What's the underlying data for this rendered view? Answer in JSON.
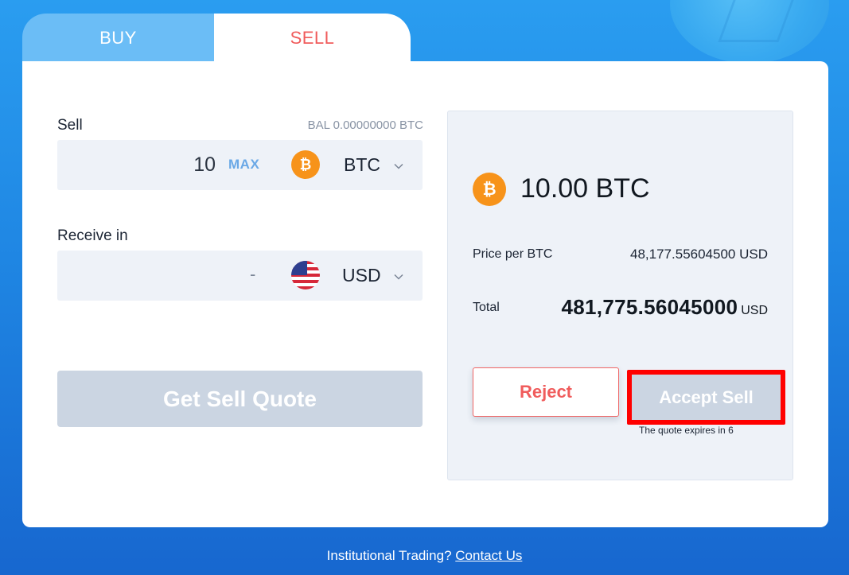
{
  "tabs": {
    "buy": "BUY",
    "sell": "SELL"
  },
  "sell_field": {
    "label": "Sell",
    "balance": "BAL 0.00000000 BTC",
    "amount": "10",
    "max_label": "MAX",
    "currency": "BTC",
    "currency_icon": "bitcoin-icon"
  },
  "receive_field": {
    "label": "Receive in",
    "amount": "-",
    "currency": "USD",
    "currency_icon": "us-flag-icon"
  },
  "get_quote_label": "Get Sell Quote",
  "quote": {
    "amount": "10.00 BTC",
    "price_label": "Price per BTC",
    "price_value": "48,177.55604500 USD",
    "total_label": "Total",
    "total_value": "481,775.56045000",
    "total_currency": "USD",
    "reject_label": "Reject",
    "accept_label": "Accept Sell",
    "expire_text": "The quote expires in 6"
  },
  "footer": {
    "text": "Institutional Trading?",
    "link": "Contact Us"
  },
  "colors": {
    "accent_red": "#f05c5c",
    "btc_orange": "#f7931a",
    "disabled_gray": "#cbd5e2",
    "highlight_box": "#ff0000"
  }
}
